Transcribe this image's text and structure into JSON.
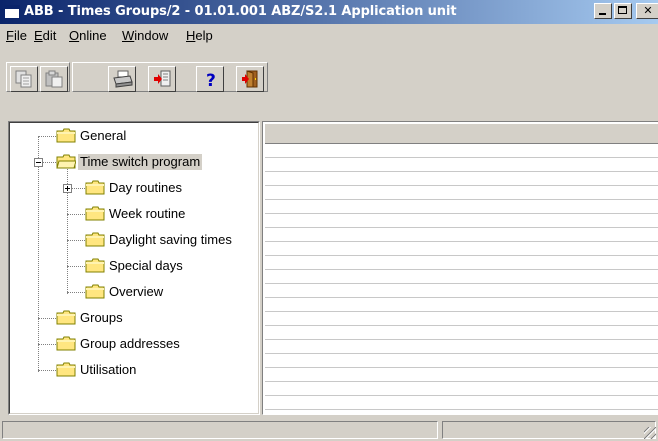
{
  "window": {
    "title": "ABB - Times Groups/2 - 01.01.001 ABZ/S2.1 Application unit"
  },
  "menu": [
    {
      "label_u": "F",
      "label_rest": "ile"
    },
    {
      "label_u": "E",
      "label_rest": "dit"
    },
    {
      "label_u": "O",
      "label_rest": "nline"
    },
    {
      "label_u": "W",
      "label_rest": "indow"
    },
    {
      "label_u": "H",
      "label_rest": "elp"
    }
  ],
  "toolbar": {
    "icons": [
      "copy-icon",
      "paste-icon",
      "print-icon",
      "import-icon",
      "help-icon",
      "exit-icon"
    ]
  },
  "tree": {
    "items": [
      {
        "label": "General"
      },
      {
        "label": "Time switch program"
      },
      {
        "label": "Day routines"
      },
      {
        "label": "Week routine"
      },
      {
        "label": "Daylight saving times"
      },
      {
        "label": "Special days"
      },
      {
        "label": "Overview"
      },
      {
        "label": "Groups"
      },
      {
        "label": "Group addresses"
      },
      {
        "label": "Utilisation"
      }
    ]
  },
  "colors": {
    "titlebar_start": "#0a246a",
    "titlebar_end": "#a6caf0",
    "folder_fill": "#ffe680",
    "window_face": "#d4d0c8"
  }
}
